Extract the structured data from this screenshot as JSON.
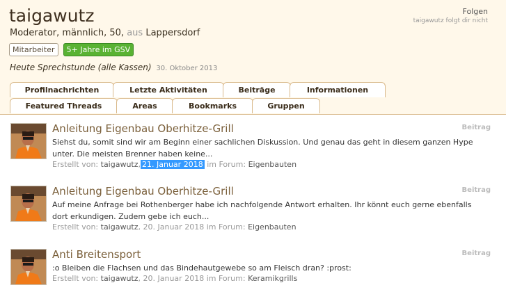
{
  "profile": {
    "username": "taigawutz",
    "role_gender_age": "Moderator, männlich, 50,",
    "aus": "aus",
    "location": "Lappersdorf",
    "badges": {
      "staff": "Mitarbeiter",
      "years": "5+ Jahre im GSV"
    },
    "status_text": "Heute Sprechstunde (alle Kassen)",
    "status_date": "30. Oktober 2013",
    "follow_label": "Folgen",
    "follow_note": "taigawutz folgt dir nicht"
  },
  "tabs": [
    "Profilnachrichten",
    "Letzte Aktivitäten",
    "Beiträge",
    "Informationen",
    "Featured Threads",
    "Areas",
    "Bookmarks",
    "Gruppen"
  ],
  "posts": [
    {
      "title": "Anleitung Eigenbau Oberhitze-Grill",
      "type": "Beitrag",
      "snippet": "Siehst du, somit sind wir am Beginn einer sachlichen Diskussion. Und genau das geht in diesem ganzen Hype unter. Die meisten Brenner haben keine...",
      "created_by": "Erstellt von:",
      "author": "taigawutz",
      "date": "21. Januar 2018",
      "in_forum": "im Forum:",
      "forum": "Eigenbauten"
    },
    {
      "title": "Anleitung Eigenbau Oberhitze-Grill",
      "type": "Beitrag",
      "snippet": "Auf meine Anfrage bei Rothenberger habe ich nachfolgende Antwort erhalten. Ihr könnt euch gerne ebenfalls dort erkundigen. Zudem gebe ich euch...",
      "created_by": "Erstellt von:",
      "author": "taigawutz",
      "date": "20. Januar 2018",
      "in_forum": "im Forum:",
      "forum": "Eigenbauten"
    },
    {
      "title": "Anti Breitensport",
      "type": "Beitrag",
      "snippet": ":o Bleiben die Flachsen und das Bindehautgewebe so am Fleisch dran? :prost:",
      "created_by": "Erstellt von:",
      "author": "taigawutz",
      "date": "20. Januar 2018",
      "in_forum": "im Forum:",
      "forum": "Keramikgrills"
    }
  ]
}
